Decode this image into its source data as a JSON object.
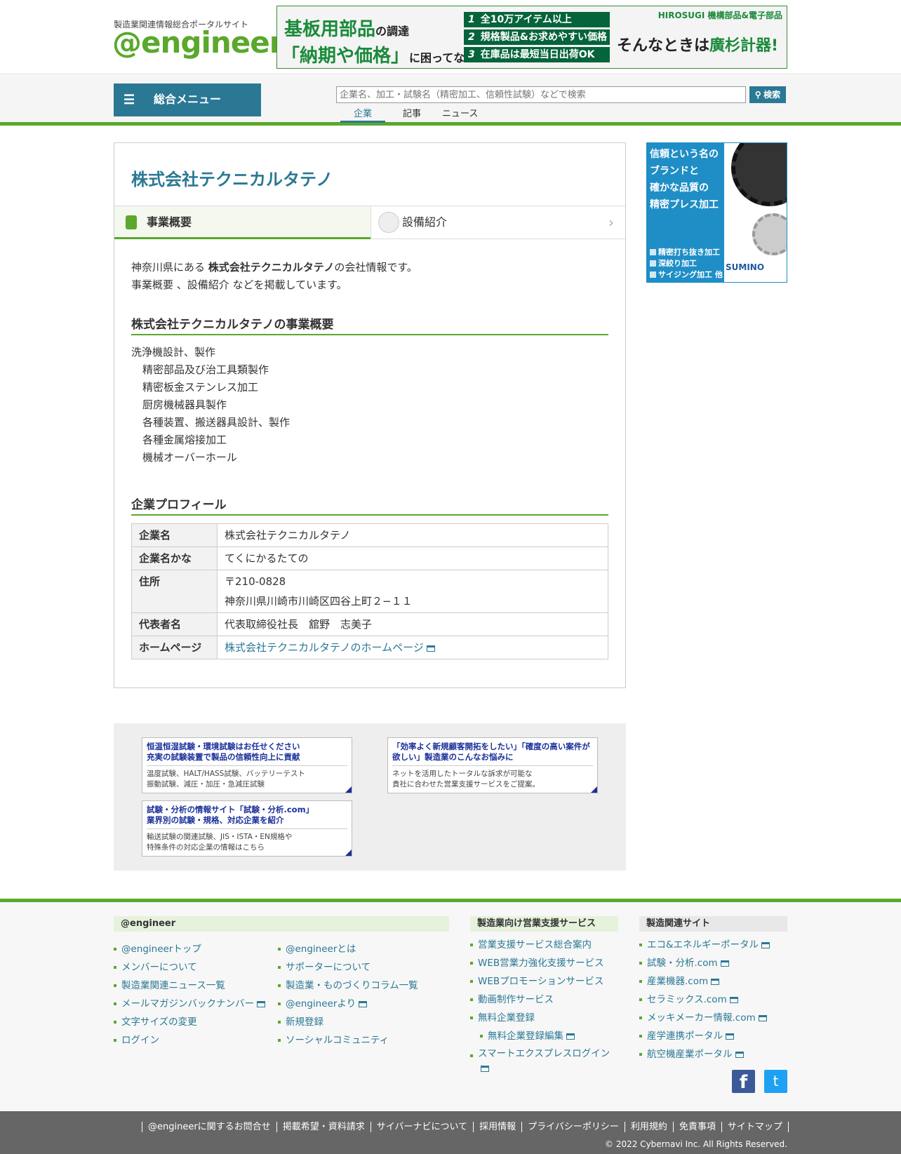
{
  "header": {
    "tagline": "製造業関連情報総合ポータルサイト",
    "logo": "@engineer",
    "banner": {
      "line1": "基板用部品",
      "line1_suffix": "の調達",
      "line2": "「納期や価格」",
      "line2_suffix": "に困ってない?",
      "features": [
        {
          "num": "1",
          "text": "全10万アイテム以上"
        },
        {
          "num": "2",
          "text": "規格製品&お求めやすい価格"
        },
        {
          "num": "3",
          "text": "在庫品は最短当日出荷OK"
        }
      ],
      "brand": "HIROSUGI 機構部品&電子部品",
      "right_text": "そんなときは",
      "right_brand": "廣杉計器!"
    }
  },
  "nav": {
    "menu_label": "総合メニュー",
    "search_placeholder": "企業名、加工・試験名（精密加工、信頼性試験）などで検索",
    "search_button": "検索",
    "tabs": [
      "企業",
      "記事",
      "ニュース"
    ]
  },
  "company": {
    "name": "株式会社テクニカルタテノ",
    "tabs": {
      "overview": "事業概要",
      "equipment": "設備紹介"
    },
    "intro_prefix": "神奈川県にある",
    "intro_name": "株式会社テクニカルタテノ",
    "intro_suffix": "の会社情報です。",
    "intro_line2": "事業概要 、設備紹介 などを掲載しています。",
    "overview_heading": "株式会社テクニカルタテノの事業概要",
    "overview_items": [
      "洗浄機設計、製作",
      "精密部品及び治工具類製作",
      "精密板金ステンレス加工",
      "厨房機械器具製作",
      "各種装置、搬送器具設計、製作",
      "各種金属熔接加工",
      "機械オーバーホール"
    ],
    "profile_heading": "企業プロフィール",
    "profile": {
      "name_label": "企業名",
      "name_value": "株式会社テクニカルタテノ",
      "kana_label": "企業名かな",
      "kana_value": "てくにかるたての",
      "address_label": "住所",
      "address_postal": "〒210-0828",
      "address_line": "神奈川県川崎市川崎区四谷上町２−１１",
      "rep_label": "代表者名",
      "rep_value": "代表取締役社長　舘野　志美子",
      "hp_label": "ホームページ",
      "hp_value": "株式会社テクニカルタテノのホームページ"
    }
  },
  "ads": [
    {
      "title": "恒温恒湿試験・環境試験はお任せください\n充実の試験装置で製品の信頼性向上に貢献",
      "desc": "温度試験、HALT/HASS試験、バッテリーテスト\n振動試験、減圧・加圧・急減圧試験"
    },
    {
      "title": "「効率よく新規顧客開拓をしたい」「確度の高い案件が欲しい」製造業のこんなお悩みに",
      "desc": "ネットを活用したトータルな訴求が可能な\n貴社に合わせた営業支援サービスをご提案。"
    },
    {
      "title": "試験・分析の情報サイト「試験・分析.com」\n業界別の試験・規格、対応企業を紹介",
      "desc": "輸送試験の関連試験、JIS・ISTA・EN規格や\n特殊条件の対応企業の情報はこちら"
    }
  ],
  "side_ad": {
    "lines": [
      "信頼という名の",
      "ブランドと",
      "確かな品質の",
      "精密プレス加工"
    ],
    "features": [
      "精密打ち抜き加工",
      "深絞り加工",
      "サイジング加工 他"
    ],
    "brand": "SUMINO"
  },
  "footer": {
    "h_engineer": "@engineer",
    "h_sales": "製造業向け営業支援サービス",
    "h_related": "製造関連サイト",
    "col1": [
      "@engineerトップ",
      "メンバーについて",
      "製造業関連ニュース一覧",
      "メールマガジンバックナンバー",
      "文字サイズの変更",
      "ログイン"
    ],
    "col2": [
      "@engineerとは",
      "サポーターについて",
      "製造業・ものづくりコラム一覧",
      "@engineerより",
      "新規登録",
      "ソーシャルコミュニティ"
    ],
    "col3": [
      "営業支援サービス総合案内",
      "WEB営業力強化支援サービス",
      "WEBプロモーションサービス",
      "動画制作サービス",
      "無料企業登録",
      "無料企業登録編集",
      "スマートエクスプレスログイン"
    ],
    "col4": [
      "エコ&エネルギーポータル",
      "試験・分析.com",
      "産業機器.com",
      "セラミックス.com",
      "メッキメーカー情報.com",
      "産学連携ポータル",
      "航空機産業ポータル"
    ],
    "social": {
      "facebook": "f",
      "twitter": "t"
    },
    "bottom_links": [
      "@engineerに関するお問合せ",
      "掲載希望・資料請求",
      "サイバーナビについて",
      "採用情報",
      "プライバシーポリシー",
      "利用規約",
      "免責事項",
      "サイトマップ"
    ],
    "copyright": "© 2022 Cybernavi Inc. All Rights Reserved."
  }
}
